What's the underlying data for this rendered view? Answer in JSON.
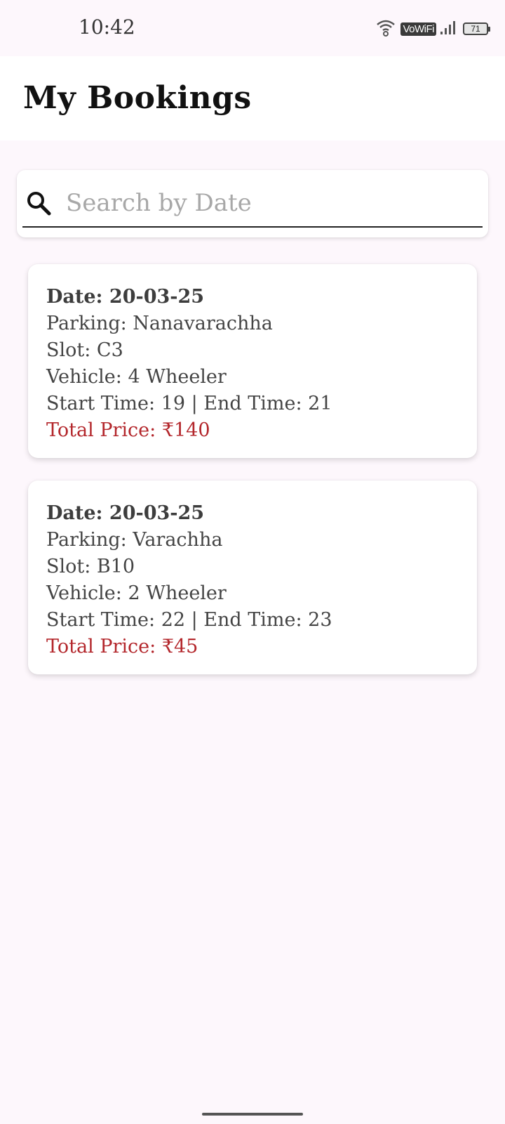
{
  "status_bar": {
    "time": "10:42",
    "network_label": "VoWiFi",
    "battery": "71"
  },
  "header": {
    "title": "My Bookings"
  },
  "search": {
    "placeholder": "Search by Date",
    "value": "",
    "icon": "search-icon"
  },
  "bookings": [
    {
      "date": "Date: 20-03-25",
      "parking": "Parking: Nanavarachha",
      "slot": "Slot: C3",
      "vehicle": "Vehicle: 4 Wheeler",
      "times": "Start Time: 19 | End Time: 21",
      "price": "Total Price: ₹140"
    },
    {
      "date": "Date: 20-03-25",
      "parking": "Parking: Varachha",
      "slot": "Slot: B10",
      "vehicle": "Vehicle: 2 Wheeler",
      "times": "Start Time: 22 | End Time: 23",
      "price": "Total Price: ₹45"
    }
  ],
  "colors": {
    "background": "#fdf7fc",
    "price": "#b3262b",
    "card": "#ffffff"
  }
}
